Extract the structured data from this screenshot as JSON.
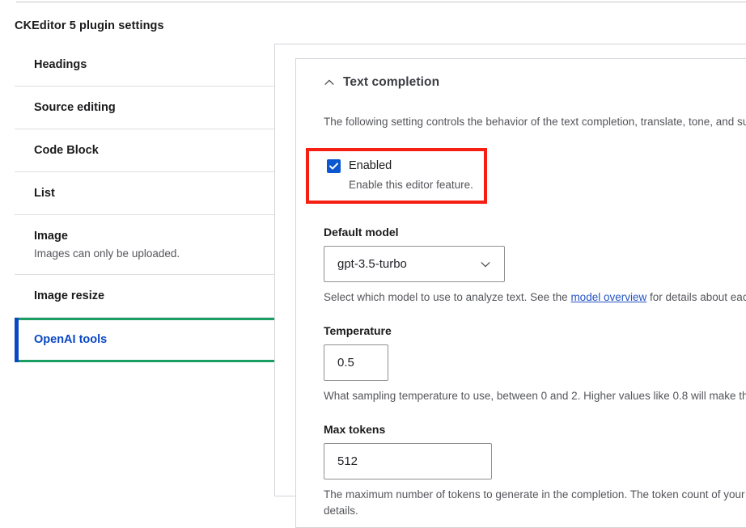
{
  "page": {
    "title": "CKEditor 5 plugin settings"
  },
  "sidebar": {
    "items": [
      {
        "label": "Headings",
        "desc": "",
        "active": false
      },
      {
        "label": "Source editing",
        "desc": "",
        "active": false
      },
      {
        "label": "Code Block",
        "desc": "",
        "active": false
      },
      {
        "label": "List",
        "desc": "",
        "active": false
      },
      {
        "label": "Image",
        "desc": "Images can only be uploaded.",
        "active": false
      },
      {
        "label": "Image resize",
        "desc": "",
        "active": false
      },
      {
        "label": "OpenAI tools",
        "desc": "",
        "active": true
      }
    ]
  },
  "detail": {
    "section": {
      "title": "Text completion",
      "toggle_icon": "chevron-up-icon",
      "intro": "The following setting controls the behavior of the text completion, translate, tone, and su"
    },
    "enabled": {
      "label": "Enabled",
      "description": "Enable this editor feature.",
      "checked": true,
      "check_icon": "checkmark-icon",
      "highlight_color": "#f51f12"
    },
    "default_model": {
      "label": "Default model",
      "value": "gpt-3.5-turbo",
      "arrow_icon": "chevron-down-icon",
      "desc_before_link": "Select which model to use to analyze text. See the ",
      "desc_link": "model overview",
      "desc_after_link": " for details about each"
    },
    "temperature": {
      "label": "Temperature",
      "value": "0.5",
      "description": "What sampling temperature to use, between 0 and 2. Higher values like 0.8 will make the"
    },
    "max_tokens": {
      "label": "Max tokens",
      "value": "512",
      "description": "The maximum number of tokens to generate in the completion. The token count of your p details."
    }
  },
  "colors": {
    "accent_blue": "#0a47c2",
    "active_green": "#1a9e63",
    "checkbox_blue": "#0a57d0",
    "highlight_red": "#f51f12",
    "link_blue": "#2453c2"
  }
}
